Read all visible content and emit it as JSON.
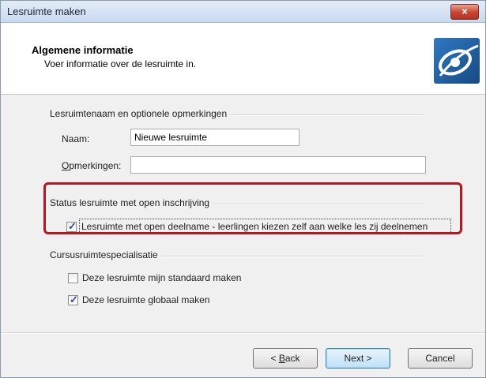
{
  "window": {
    "title": "Lesruimte maken",
    "close_label": "×"
  },
  "header": {
    "title": "Algemene informatie",
    "subtitle": "Voer informatie over de lesruimte in."
  },
  "group_name": {
    "label": "Lesruimtenaam en optionele opmerkingen",
    "name_label": "Naam:",
    "name_value": "Nieuwe lesruimte",
    "remarks_label_underlined": "O",
    "remarks_label_rest": "pmerkingen:",
    "remarks_value": ""
  },
  "group_status": {
    "label": "Status lesruimte met open inschrijving",
    "open_checkbox_label": "Lesruimte met open deelname - leerlingen kiezen zelf aan welke les zij deelnemen",
    "open_checkbox_checked": true
  },
  "group_spec": {
    "label": "Cursusruimtespecialisatie",
    "standard_label": "Deze lesruimte mijn standaard maken",
    "standard_checked": false,
    "global_label": "Deze lesruimte globaal maken",
    "global_checked": true
  },
  "footer": {
    "back_prefix": "< ",
    "back_underlined": "B",
    "back_rest": "ack",
    "next_label": "Next >",
    "cancel_label": "Cancel"
  },
  "colors": {
    "highlight": "#b8161f",
    "titlebar": "#c9daf0",
    "check": "#2a4d9c",
    "logo": "#1d5c9c"
  },
  "icons": {
    "close": "close-icon",
    "logo": "eye-swoosh-logo-icon",
    "check": "checkmark-icon"
  }
}
